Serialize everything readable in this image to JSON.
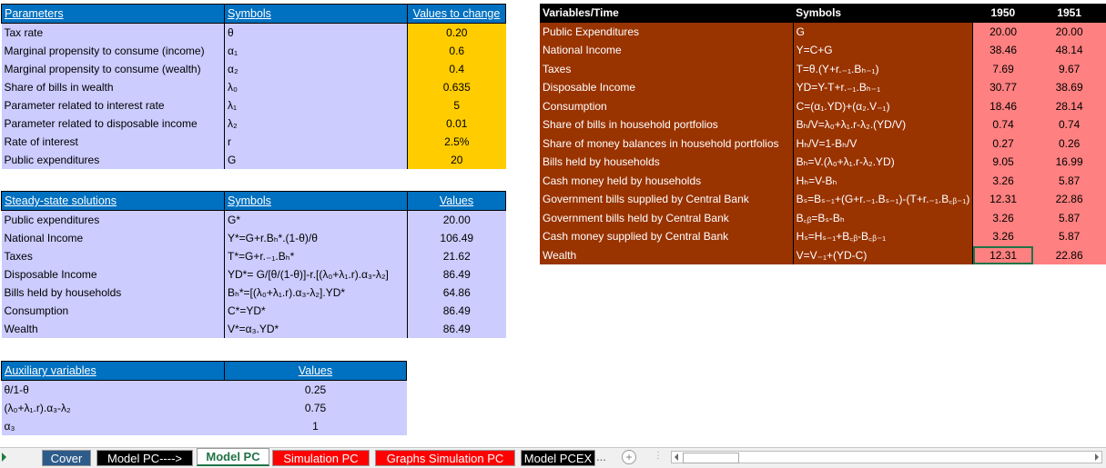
{
  "parameters": {
    "headers": [
      "Parameters",
      "Symbols",
      "Values to change"
    ],
    "rows": [
      [
        "Tax rate",
        "θ",
        "0.20"
      ],
      [
        "Marginal propensity to consume (income)",
        "α₁",
        "0.6"
      ],
      [
        "Marginal propensity to consume (wealth)",
        "α₂",
        "0.4"
      ],
      [
        "Share of bills in wealth",
        "λ₀",
        "0.635"
      ],
      [
        "Parameter related to interest rate",
        "λ₁",
        "5"
      ],
      [
        "Parameter related to disposable income",
        "λ₂",
        "0.01"
      ],
      [
        "Rate of interest",
        "r",
        "2.5%"
      ],
      [
        "Public expenditures",
        "G",
        "20"
      ]
    ]
  },
  "steady_state": {
    "headers": [
      "Steady-state solutions",
      "Symbols",
      "Values"
    ],
    "rows": [
      [
        "Public expenditures",
        "G*",
        "20.00"
      ],
      [
        "National Income",
        "Y*=G+r.Bₕ*.(1-θ)/θ",
        "106.49"
      ],
      [
        "Taxes",
        "T*=G+r.₋₁.Bₕ*",
        "21.62"
      ],
      [
        "Disposable Income",
        "YD*= G/[θ/(1-θ)]-r.[(λ₀+λ₁.r).α₃-λ₂]",
        "86.49"
      ],
      [
        "Bills held by households",
        "Bₕ*=[(λ₀+λ₁.r).α₃-λ₂].YD*",
        "64.86"
      ],
      [
        "Consumption",
        "C*=YD*",
        "86.49"
      ],
      [
        "Wealth",
        "V*=α₃.YD*",
        "86.49"
      ]
    ]
  },
  "auxiliary": {
    "headers": [
      "Auxiliary variables",
      "Values"
    ],
    "rows": [
      [
        "θ/1-θ",
        "0.25"
      ],
      [
        "(λ₀+λ₁.r).α₃-λ₂",
        "0.75"
      ],
      [
        "α₃",
        "1"
      ]
    ]
  },
  "variables": {
    "headers": [
      "Variables/Time",
      "Symbols",
      "1950",
      "1951"
    ],
    "rows": [
      [
        "Public Expenditures",
        "G",
        "20.00",
        "20.00"
      ],
      [
        "National Income",
        "Y=C+G",
        "38.46",
        "48.14"
      ],
      [
        "Taxes",
        "T=θ.(Y+r.₋₁.Bₕ₋₁)",
        "7.69",
        "9.67"
      ],
      [
        "Disposable Income",
        "YD=Y-T+r.₋₁.Bₕ₋₁",
        "30.77",
        "38.69"
      ],
      [
        "Consumption",
        "C=(α₁.YD)+(α₂.V₋₁)",
        "18.46",
        "28.14"
      ],
      [
        "Share of bills in household portfolios",
        "Bₕ/V=λ₀+λ₁.r-λ₂.(YD/V)",
        "0.74",
        "0.74"
      ],
      [
        "Share of money balances in household portfolios",
        "Hₕ/V=1-Bₕ/V",
        "0.27",
        "0.26"
      ],
      [
        "Bills held by households",
        "Bₕ=V.(λ₀+λ₁.r-λ₂.YD)",
        "9.05",
        "16.99"
      ],
      [
        "Cash money held by households",
        "Hₕ=V-Bₕ",
        "3.26",
        "5.87"
      ],
      [
        "Government bills supplied by Central Bank",
        "Bₛ=Bₛ₋₁+(G+r.₋₁.Bₛ₋₁)-(T+r.₋₁.B꜀ᵦ₋₁)",
        "12.31",
        "22.86"
      ],
      [
        "Government bills held by Central Bank",
        "B꜀ᵦ=Bₛ-Bₕ",
        "3.26",
        "5.87"
      ],
      [
        "Cash money supplied by Central Bank",
        "Hₛ=Hₛ₋₁+B꜀ᵦ-B꜀ᵦ₋₁",
        "3.26",
        "5.87"
      ],
      [
        "Wealth",
        "V=V₋₁+(YD-C)",
        "12.31",
        "22.86"
      ]
    ]
  },
  "sheet_tabs": [
    {
      "label": "Cover",
      "bg": "#2e5c8a",
      "fg": "#ffffff"
    },
    {
      "label": "Model PC---->",
      "bg": "#000000",
      "fg": "#ffffff"
    },
    {
      "label": "Model PC",
      "bg": "#ffffff",
      "fg": "#217346"
    },
    {
      "label": "Simulation PC",
      "bg": "#ff0000",
      "fg": "#ffffff"
    },
    {
      "label": "Graphs Simulation PC",
      "bg": "#ff0000",
      "fg": "#ffffff"
    },
    {
      "label": "Model PCEX",
      "bg": "#000000",
      "fg": "#ffffff"
    }
  ],
  "tabbar": {
    "ellipsis": "...",
    "add": "+",
    "more": "⋮"
  },
  "colors": {
    "header_blue": "#0070c0",
    "lavender": "#ccccff",
    "yellow": "#ffcc00",
    "brown": "#993300",
    "pink": "#ff8080"
  }
}
